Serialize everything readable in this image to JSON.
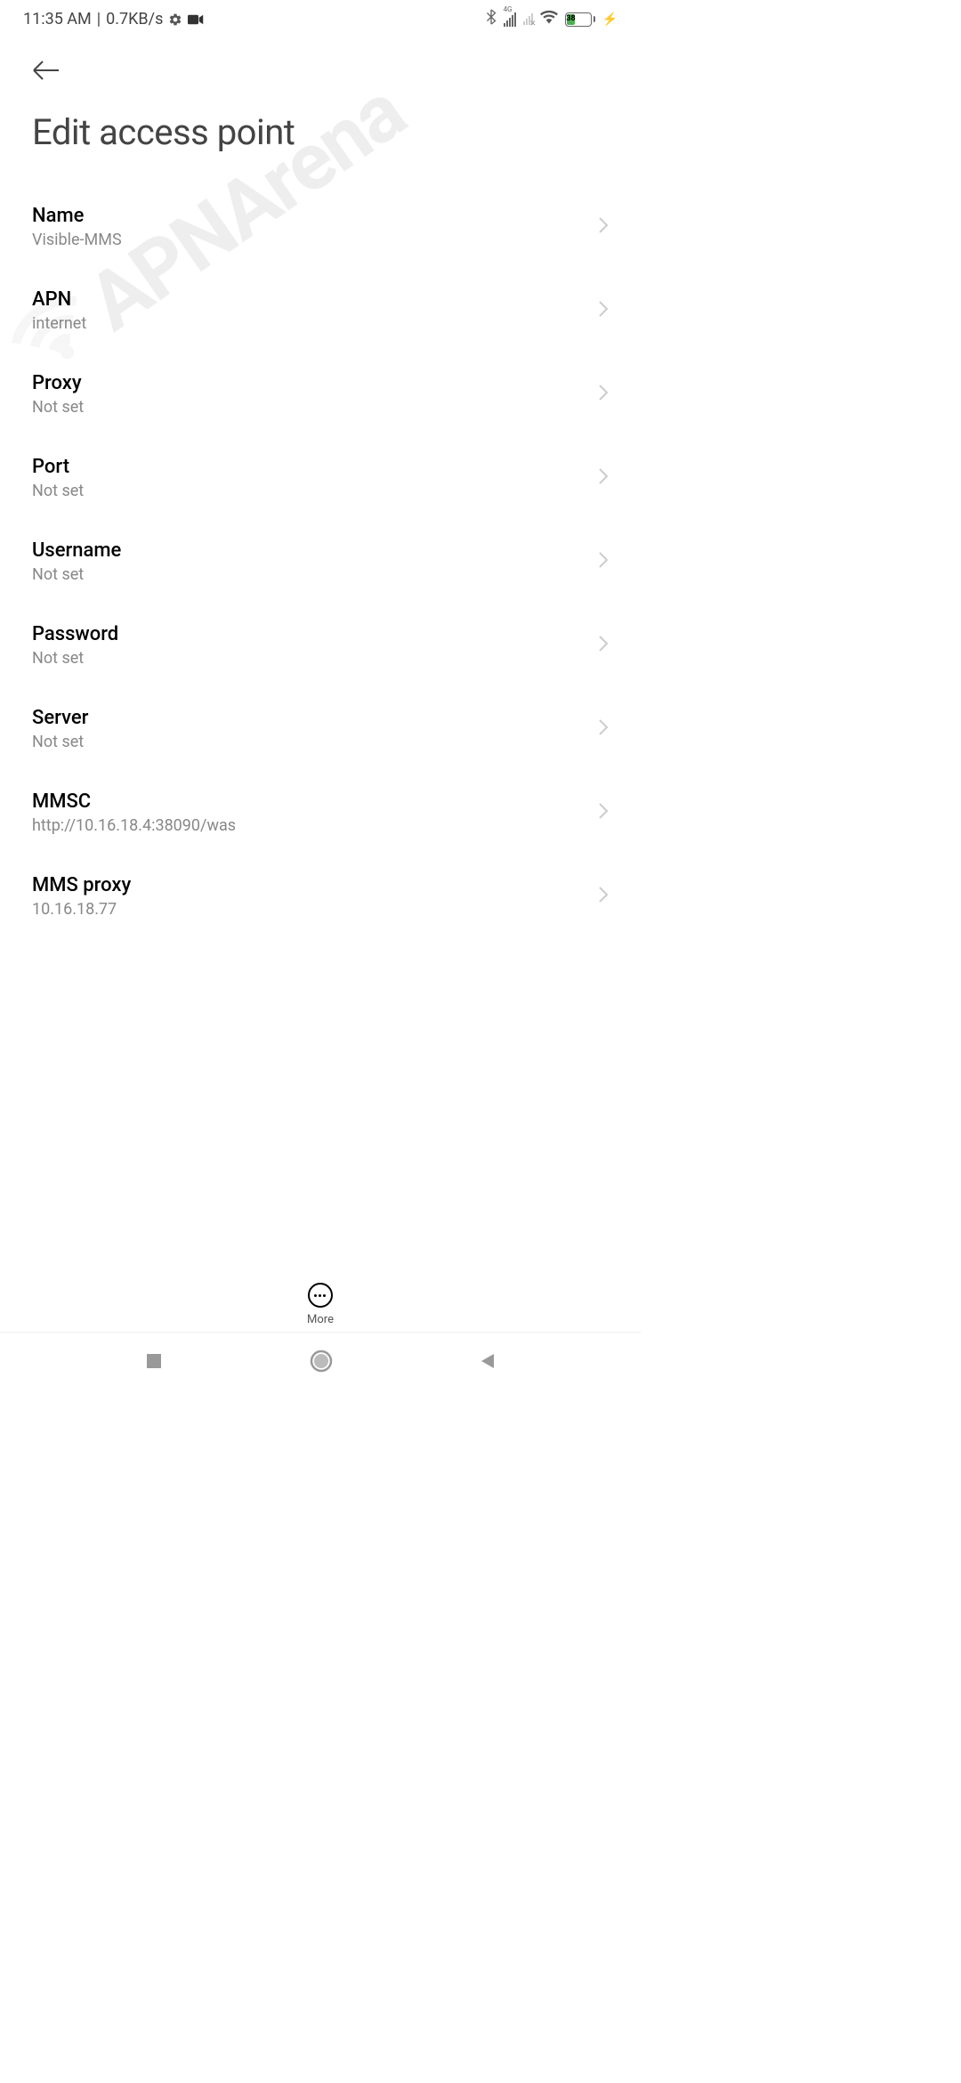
{
  "status_bar": {
    "time": "11:35 AM",
    "separator": "|",
    "data_rate": "0.7KB/s",
    "signal_label": "4G",
    "battery_pct": "38"
  },
  "header": {
    "title": "Edit access point"
  },
  "settings": [
    {
      "label": "Name",
      "value": "Visible-MMS"
    },
    {
      "label": "APN",
      "value": "internet"
    },
    {
      "label": "Proxy",
      "value": "Not set"
    },
    {
      "label": "Port",
      "value": "Not set"
    },
    {
      "label": "Username",
      "value": "Not set"
    },
    {
      "label": "Password",
      "value": "Not set"
    },
    {
      "label": "Server",
      "value": "Not set"
    },
    {
      "label": "MMSC",
      "value": "http://10.16.18.4:38090/was"
    },
    {
      "label": "MMS proxy",
      "value": "10.16.18.77"
    }
  ],
  "bottom": {
    "more_label": "More"
  },
  "watermark": {
    "text": "APNArena"
  }
}
